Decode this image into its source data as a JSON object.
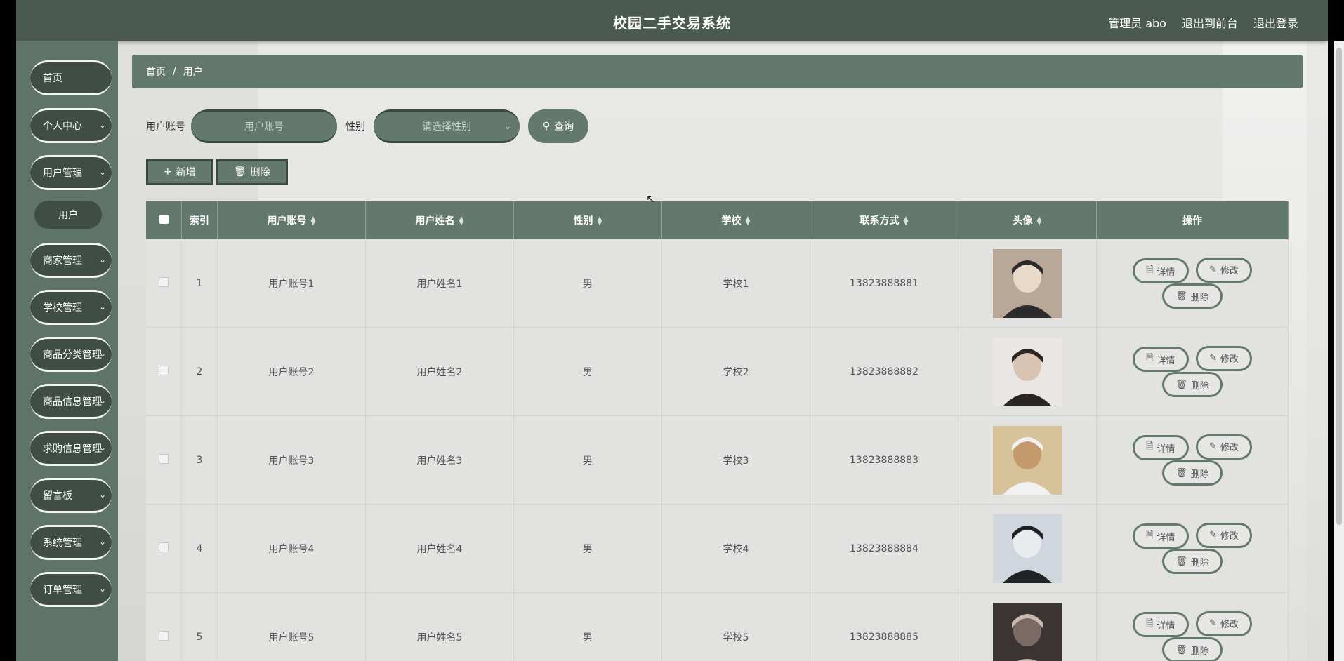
{
  "header": {
    "title": "校园二手交易系统",
    "admin": "管理员 abo",
    "to_front": "退出到前台",
    "logout": "退出登录"
  },
  "sidebar": {
    "items": [
      {
        "label": "首页",
        "has_children": false
      },
      {
        "label": "个人中心",
        "has_children": true
      },
      {
        "label": "用户管理",
        "has_children": true,
        "children": [
          "用户"
        ]
      },
      {
        "label": "商家管理",
        "has_children": true
      },
      {
        "label": "学校管理",
        "has_children": true
      },
      {
        "label": "商品分类管理",
        "has_children": true
      },
      {
        "label": "商品信息管理",
        "has_children": true
      },
      {
        "label": "求购信息管理",
        "has_children": true
      },
      {
        "label": "留言板",
        "has_children": true
      },
      {
        "label": "系统管理",
        "has_children": true
      },
      {
        "label": "订单管理",
        "has_children": true
      }
    ]
  },
  "breadcrumb": {
    "home": "首页",
    "current": "用户"
  },
  "search": {
    "account_label": "用户账号",
    "account_placeholder": "用户账号",
    "gender_label": "性别",
    "gender_placeholder": "请选择性别",
    "query_button": "查询"
  },
  "actions": {
    "add": "新增",
    "delete": "删除"
  },
  "table": {
    "headers": [
      "索引",
      "用户账号",
      "用户姓名",
      "性别",
      "学校",
      "联系方式",
      "头像",
      "操作"
    ],
    "rows": [
      {
        "index": "1",
        "account": "用户账号1",
        "name": "用户姓名1",
        "gender": "男",
        "school": "学校1",
        "phone": "13823888881"
      },
      {
        "index": "2",
        "account": "用户账号2",
        "name": "用户姓名2",
        "gender": "男",
        "school": "学校2",
        "phone": "13823888882"
      },
      {
        "index": "3",
        "account": "用户账号3",
        "name": "用户姓名3",
        "gender": "男",
        "school": "学校3",
        "phone": "13823888883"
      },
      {
        "index": "4",
        "account": "用户账号4",
        "name": "用户姓名4",
        "gender": "男",
        "school": "学校4",
        "phone": "13823888884"
      },
      {
        "index": "5",
        "account": "用户账号5",
        "name": "用户姓名5",
        "gender": "男",
        "school": "学校5",
        "phone": "13823888885"
      }
    ],
    "row_actions": {
      "detail": "详情",
      "edit": "修改",
      "delete": "删除"
    }
  },
  "colors": {
    "header_bg": "#4a5a51",
    "sidebar_bg": "#5f7469",
    "menu_item_bg": "#3f4d44",
    "accent": "#63796e"
  }
}
